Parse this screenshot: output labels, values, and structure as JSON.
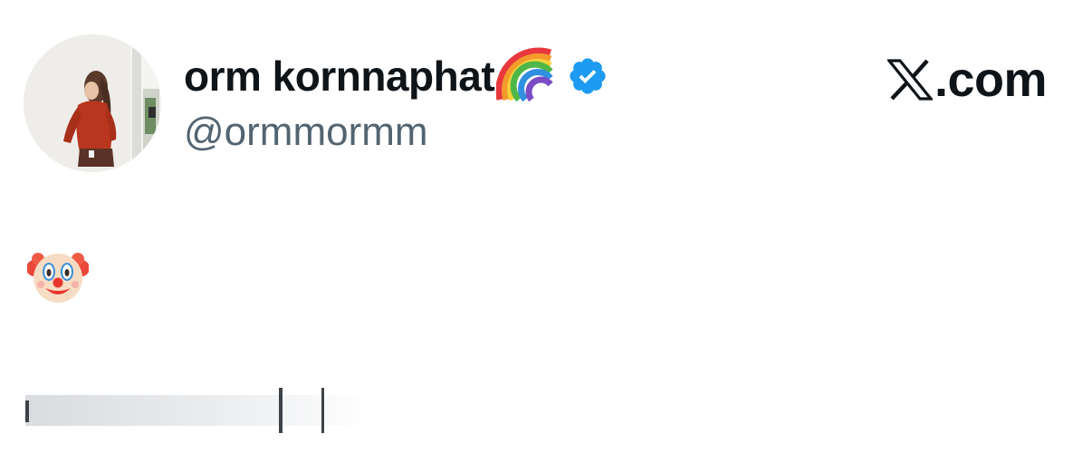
{
  "tweet": {
    "author": {
      "display_name": "orm kornnaphat",
      "name_emoji": "rainbow-icon",
      "verified": true,
      "handle": "@ormmormm"
    },
    "body_emoji": "clown-face-icon",
    "brand": {
      "logo": "x-logo-icon",
      "text": ".com"
    }
  },
  "colors": {
    "name": "#0f1419",
    "handle": "#536471",
    "verified_badge": "#1d9bf0",
    "background": "#ffffff"
  }
}
